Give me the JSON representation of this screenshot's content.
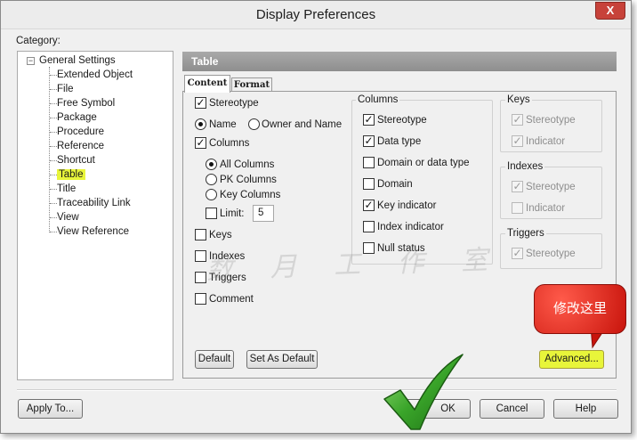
{
  "window": {
    "title": "Display Preferences",
    "close_symbol": "X"
  },
  "category": {
    "label": "Category:",
    "root": {
      "expander": "−",
      "label": "General Settings"
    },
    "items": [
      "Extended Object",
      "File",
      "Free Symbol",
      "Package",
      "Procedure",
      "Reference",
      "Shortcut",
      "Table",
      "Title",
      "Traceability Link",
      "View",
      "View Reference"
    ],
    "selected": "Table"
  },
  "panel": {
    "header": "Table"
  },
  "tabs": [
    {
      "label": "Content",
      "active": true
    },
    {
      "label": "Format",
      "active": false
    }
  ],
  "content": {
    "stereotype": {
      "label": "Stereotype",
      "checked": true
    },
    "name_radio": {
      "label": "Name",
      "checked": true
    },
    "owner_name_radio": {
      "label": "Owner and Name",
      "checked": false
    },
    "columns": {
      "label": "Columns",
      "checked": true
    },
    "all_columns": {
      "label": "All Columns",
      "checked": true
    },
    "pk_columns": {
      "label": "PK Columns",
      "checked": false
    },
    "key_columns": {
      "label": "Key Columns",
      "checked": false
    },
    "limit": {
      "label": "Limit:",
      "checked": false,
      "value": "5"
    },
    "keys": {
      "label": "Keys",
      "checked": false
    },
    "indexes": {
      "label": "Indexes",
      "checked": false
    },
    "triggers": {
      "label": "Triggers",
      "checked": false
    },
    "comment": {
      "label": "Comment",
      "checked": false
    }
  },
  "columns_group": {
    "title": "Columns",
    "items": [
      {
        "label": "Stereotype",
        "checked": true
      },
      {
        "label": "Data type",
        "checked": true
      },
      {
        "label": "Domain or data type",
        "checked": false
      },
      {
        "label": "Domain",
        "checked": false
      },
      {
        "label": "Key indicator",
        "checked": true
      },
      {
        "label": "Index indicator",
        "checked": false
      },
      {
        "label": "Null status",
        "checked": false
      }
    ]
  },
  "keys_group": {
    "title": "Keys",
    "items": [
      {
        "label": "Stereotype",
        "checked": true
      },
      {
        "label": "Indicator",
        "checked": true
      }
    ]
  },
  "indexes_group": {
    "title": "Indexes",
    "items": [
      {
        "label": "Stereotype",
        "checked": true
      },
      {
        "label": "Indicator",
        "checked": false
      }
    ]
  },
  "triggers_group": {
    "title": "Triggers",
    "items": [
      {
        "label": "Stereotype",
        "checked": true
      }
    ]
  },
  "buttons": {
    "default": "Default",
    "set_as_default": "Set As Default",
    "advanced": "Advanced...",
    "apply_to": "Apply To...",
    "ok": "OK",
    "cancel": "Cancel",
    "help": "Help"
  },
  "annotation": {
    "callout": "修改这里",
    "watermark": "数 月 工 作 室"
  },
  "icons": {
    "checkmark_overlay": "checkmark-icon"
  },
  "colors": {
    "highlight": "#e8f53a",
    "callout": "#d8201a",
    "check_green": "#3aa52a"
  }
}
